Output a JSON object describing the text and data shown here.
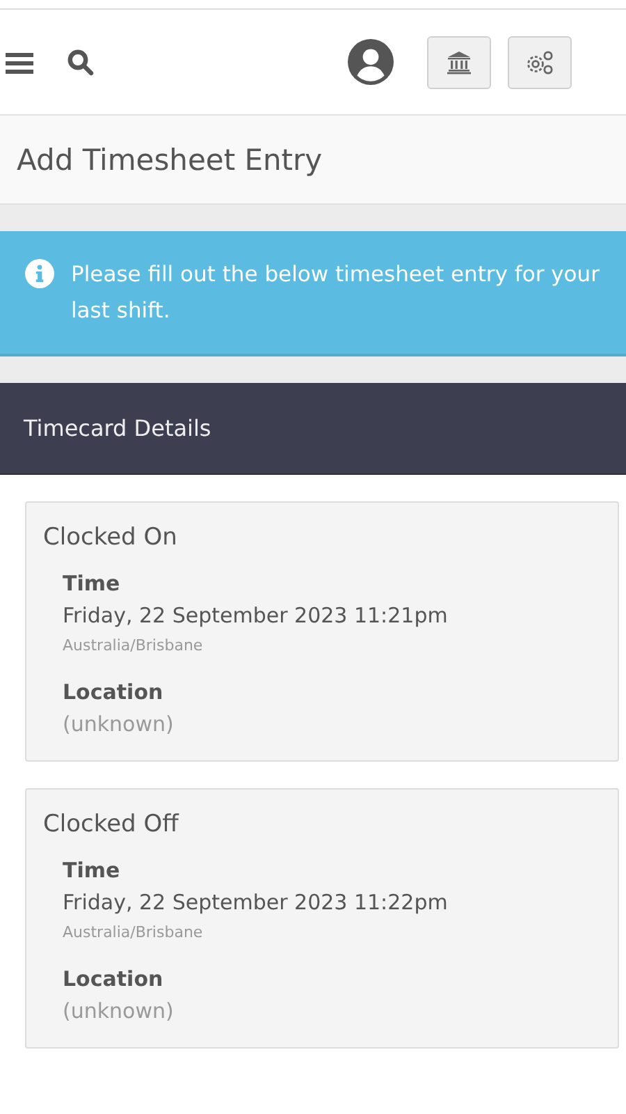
{
  "page_title": "Add Timesheet Entry",
  "alert": {
    "message": "Please fill out the below timesheet entry for your last shift."
  },
  "panel": {
    "title": "Timecard Details"
  },
  "cards": [
    {
      "title": "Clocked On",
      "fields": [
        {
          "label": "Time",
          "value": "Friday, 22 September 2023 11:21pm",
          "note": "Australia/Brisbane"
        },
        {
          "label": "Location",
          "value": "(unknown)"
        }
      ]
    },
    {
      "title": "Clocked Off",
      "fields": [
        {
          "label": "Time",
          "value": "Friday, 22 September 2023 11:22pm",
          "note": "Australia/Brisbane"
        },
        {
          "label": "Location",
          "value": "(unknown)"
        }
      ]
    }
  ]
}
